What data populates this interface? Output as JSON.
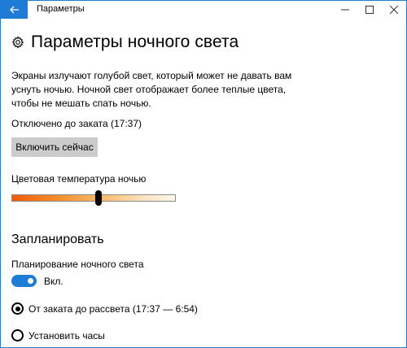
{
  "window": {
    "title": "Параметры"
  },
  "header": {
    "page_title": "Параметры ночного света"
  },
  "description": "Экраны излучают голубой свет, который может не давать вам уснуть ночью. Ночной свет отображает более теплые цвета, чтобы не мешать спать ночью.",
  "status": "Отключено до заката (17:37)",
  "enable_now_label": "Включить сейчас",
  "color_temperature": {
    "label": "Цветовая температура ночью",
    "value_fraction": 0.53
  },
  "schedule": {
    "section_title": "Запланировать",
    "toggle_label": "Планирование ночного света",
    "toggle_on": true,
    "toggle_state_text": "Вкл.",
    "options": [
      {
        "label": "От заката до рассвета (17:37 — 6:54)",
        "selected": true
      },
      {
        "label": "Установить часы",
        "selected": false
      }
    ]
  },
  "icons": {
    "back": "back-arrow-icon",
    "minimize": "minimize-icon",
    "maximize": "maximize-icon",
    "close": "close-icon",
    "settings": "gear-icon"
  },
  "colors": {
    "accent": "#1e7bd6",
    "button_bg": "#cccccc",
    "gradient_warm": "#f05a0a",
    "gradient_cool": "#fdf5ea"
  }
}
